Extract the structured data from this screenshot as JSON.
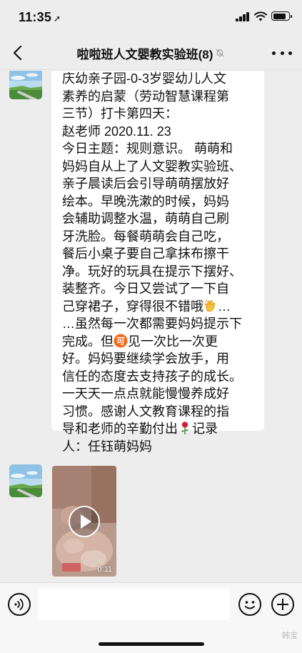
{
  "status_bar": {
    "time": "11:35",
    "location_icon": "location-arrow-icon",
    "battery_level": 0.85
  },
  "nav": {
    "back_icon": "chevron-left-icon",
    "title": "啦啦班人文婴教实验班(8)",
    "mute_icon": "bell-slash-icon",
    "more_icon": "more-dots-icon"
  },
  "messages": [
    {
      "type": "text",
      "sender_avatar": "landscape-avatar",
      "lines": [
        "庆幼亲子园-0-3岁婴幼儿人文",
        "素养的启蒙（劳动智慧课程第",
        "三节）打卡第四天：",
        "赵老师 2020.11. 23",
        "今日主题：规则意识。 萌萌和",
        "妈妈自从上了人文婴教实验班、",
        "亲子晨读后会引导萌萌摆放好",
        "绘本。早晚洗漱的时候，妈妈",
        "会辅助调整水温，萌萌自己刷",
        "牙洗脸。每餐萌萌会自己吃，",
        "餐后小桌子要自己拿抹布擦干",
        "净。玩好的玩具在提示下摆好、",
        "装整齐。今日又尝试了一下自",
        "己穿裙子，穿得很不错哦",
        "…虽然每一次都需要妈妈提示下",
        "完成。但",
        "好。妈妈要继续学会放手，用",
        "信任的态度去支持孩子的成长。",
        "一天天一点点就能慢慢养成好",
        "习惯。感谢人文教育课程的指",
        "导和老师的辛勤付出",
        "人：任钰萌妈妈"
      ],
      "inline": {
        "clap_suffix": "…",
        "ke_char": "可",
        "ke_after": "见一次比一次更",
        "rose_suffix": "记录"
      }
    },
    {
      "type": "video",
      "sender_avatar": "landscape-avatar",
      "duration": "0:11",
      "play_icon": "play-icon"
    }
  ],
  "input_bar": {
    "voice_icon": "voice-icon",
    "placeholder": "",
    "emoji_icon": "emoji-face-icon",
    "plus_icon": "plus-icon"
  },
  "watermark": "韩宝"
}
